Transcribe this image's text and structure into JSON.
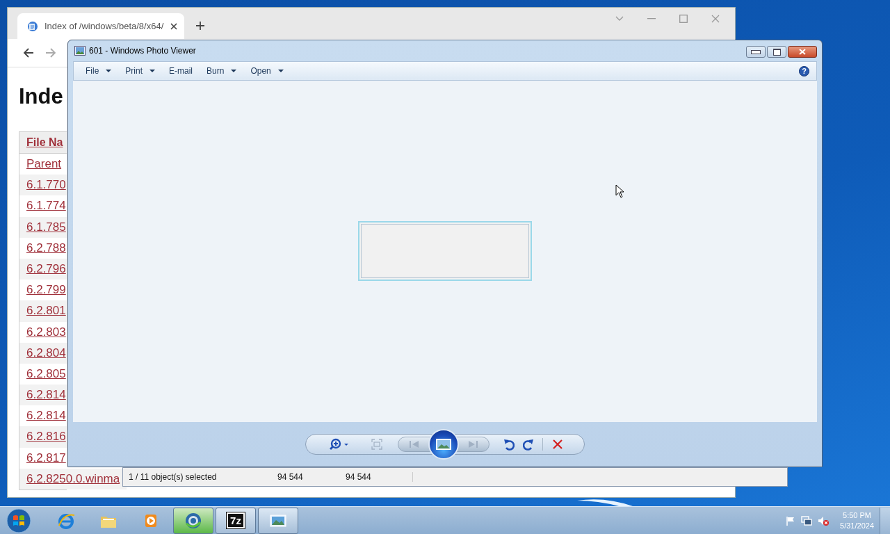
{
  "browser": {
    "tab": {
      "title": "Index of /windows/beta/8/x64/",
      "selected": true
    },
    "heading": "Inde",
    "table": {
      "header": "File Na",
      "rows": [
        "Parent",
        "6.1.770",
        "6.1.774",
        "6.1.785",
        "6.2.788",
        "6.2.796",
        "6.2.799",
        "6.2.801",
        "6.2.803",
        "6.2.804",
        "6.2.805",
        "6.2.814",
        "6.2.814",
        "6.2.816",
        "6.2.817",
        "6.2.8250.0.winma"
      ]
    }
  },
  "status_window": {
    "cells": [
      "1 / 11 object(s) selected",
      "94 544",
      "94 544"
    ]
  },
  "photo_viewer": {
    "title": "601 - Windows Photo Viewer",
    "menu": [
      {
        "label": "File",
        "dropdown": true
      },
      {
        "label": "Print",
        "dropdown": true
      },
      {
        "label": "E-mail",
        "dropdown": false
      },
      {
        "label": "Burn",
        "dropdown": true
      },
      {
        "label": "Open",
        "dropdown": true
      }
    ],
    "help": "?",
    "controls": [
      {
        "kind": "zoom",
        "disabled": false
      },
      {
        "kind": "fit",
        "disabled": true
      },
      {
        "kind": "previous",
        "disabled": true
      },
      {
        "kind": "slideshow",
        "disabled": false
      },
      {
        "kind": "next",
        "disabled": true
      },
      {
        "kind": "rotate-left",
        "disabled": false
      },
      {
        "kind": "rotate-right",
        "disabled": false
      },
      {
        "kind": "delete",
        "disabled": false
      }
    ]
  },
  "taskbar": {
    "items": [
      {
        "kind": "browser",
        "running": false
      },
      {
        "kind": "folder",
        "running": false
      },
      {
        "kind": "media",
        "running": false
      },
      {
        "kind": "globe",
        "running": true
      },
      {
        "kind": "archive",
        "running": true,
        "label": "7z"
      },
      {
        "kind": "photos",
        "running": true
      }
    ],
    "clock": {
      "time": "5:50 PM",
      "date": "5/31/2024"
    }
  }
}
